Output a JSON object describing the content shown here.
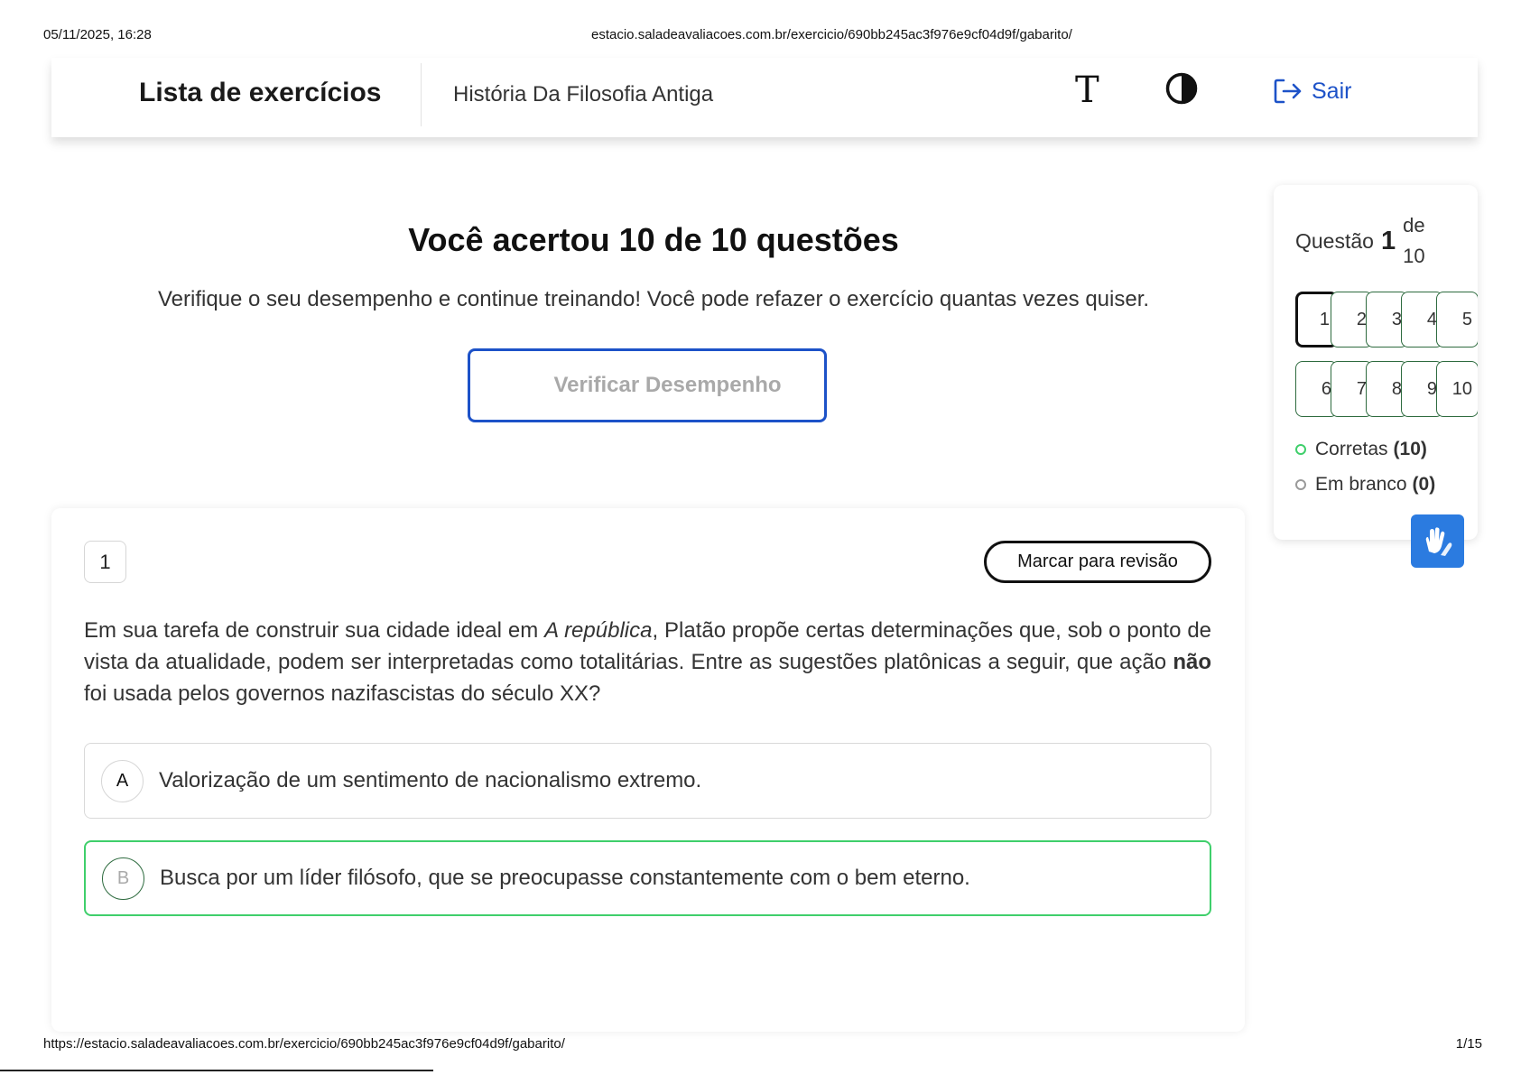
{
  "print_header": {
    "datetime": "05/11/2025, 16:28",
    "url": "estacio.saladeavaliacoes.com.br/exercicio/690bb245ac3f976e9cf04d9f/gabarito/"
  },
  "print_footer": {
    "url": "https://estacio.saladeavaliacoes.com.br/exercicio/690bb245ac3f976e9cf04d9f/gabarito/",
    "page": "1/15"
  },
  "topbar": {
    "title": "Lista de exercícios",
    "course": "História Da Filosofia Antiga",
    "font_icon": "T",
    "logout_label": "Sair"
  },
  "result": {
    "title": "Você acertou 10 de 10 questões",
    "subtitle": "Verifique o seu desempenho e continue treinando! Você pode refazer o exercício quantas vezes quiser.",
    "verify_button": "Verificar Desempenho"
  },
  "question": {
    "number": "1",
    "review_button": "Marcar para revisão",
    "text_part1": "Em sua tarefa de construir sua cidade ideal em ",
    "text_italic": "A república",
    "text_part2": ", Platão propõe certas determinações que, sob o ponto de vista da atualidade, podem ser interpretadas como totalitárias. Entre as sugestões platônicas a seguir, que ação ",
    "text_bold": "não",
    "text_part3": " foi usada pelos governos nazifascistas do século XX?",
    "options": [
      {
        "letter": "A",
        "text": "Valorização de um sentimento de nacionalismo extremo.",
        "correct": false
      },
      {
        "letter": "B",
        "text": "Busca por um líder filósofo, que se preocupasse constantemente com o bem eterno.",
        "correct": true
      }
    ]
  },
  "sidebar": {
    "label": "Questão",
    "current": "1",
    "total": "de 10",
    "row1": [
      "1",
      "2",
      "3",
      "4",
      "5"
    ],
    "row2": [
      "6",
      "7",
      "8",
      "9",
      "10"
    ],
    "legend": [
      {
        "label": "Corretas",
        "count": "(10)",
        "color": "#3fcf6b"
      },
      {
        "label": "Em branco",
        "count": "(0)",
        "color": "#9a9a9a"
      }
    ]
  },
  "colors": {
    "accent": "#1d52c8",
    "correct": "#3fcf6b",
    "libras_button": "#2b7be0"
  },
  "icons": [
    "font-size-icon",
    "contrast-icon",
    "logout-icon",
    "libras-hands-icon"
  ]
}
